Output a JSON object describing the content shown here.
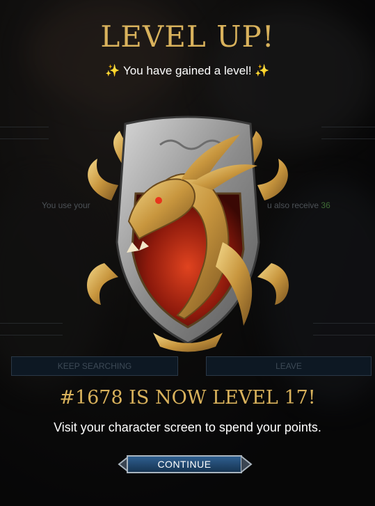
{
  "popup": {
    "title": "LEVEL UP!",
    "subtitle": "You have gained a level!",
    "spark_glyph": "✨",
    "level_message": "#1678 IS NOW LEVEL 17!",
    "instruction": "Visit your character screen to spend your points.",
    "continue_label": "CONTINUE",
    "emblem_icon": "dragon-crest-icon"
  },
  "background": {
    "text_left": "You use your",
    "text_right_prefix": "u also receive",
    "text_right_number": "36",
    "keep_searching_label": "KEEP SEARCHING",
    "leave_label": "LEAVE"
  },
  "colors": {
    "gold_text": "#d9b25c",
    "button_blue": "#1f4a75",
    "spark": "#f3c84a"
  }
}
